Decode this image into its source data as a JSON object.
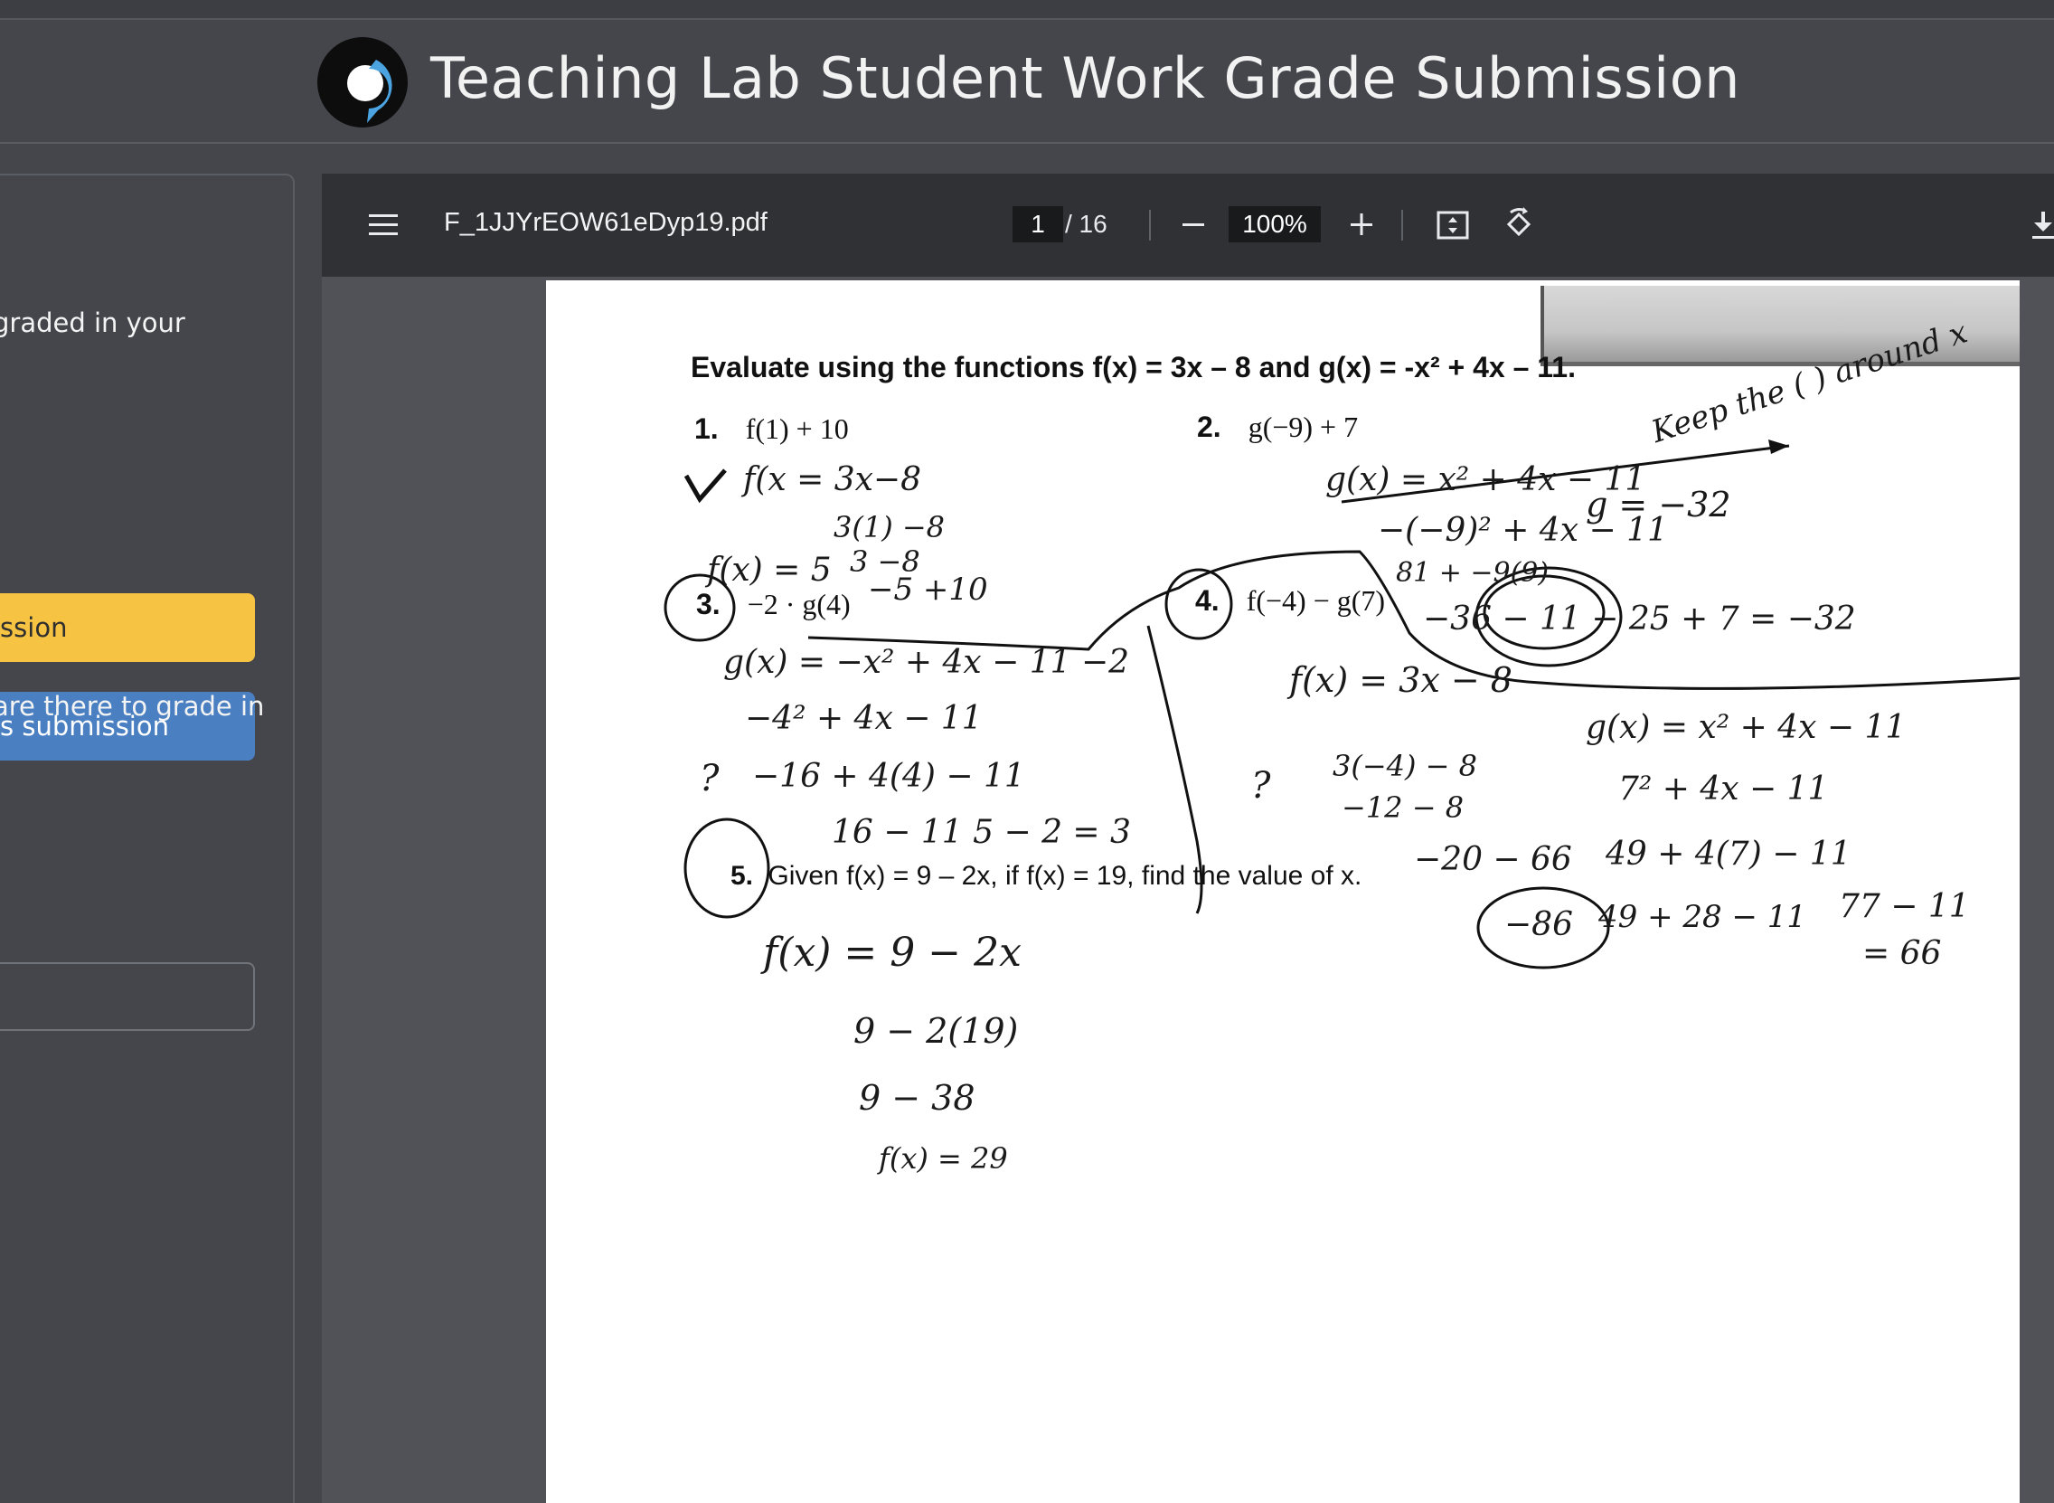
{
  "app": {
    "title": "Teaching Lab Student Work Grade Submission"
  },
  "sidebar": {
    "text_graded": "graded in your",
    "yellow_button": "ission",
    "blue_button": "is submission",
    "text_count": "are there to grade in",
    "input_value": ""
  },
  "viewer": {
    "filename": "F_1JJYrEOW61eDyp19.pdf",
    "page_current": "1",
    "page_total": "/ 16",
    "zoom": "100%",
    "icons": [
      "menu-icon",
      "zoom-out-icon",
      "zoom-in-icon",
      "fit-page-icon",
      "rotate-icon",
      "download-icon"
    ]
  },
  "document": {
    "heading": "Evaluate using the functions f(x) = 3x – 8 and g(x) = -x² + 4x – 11.",
    "q1_num": "1.",
    "q1_expr": "f(1) + 10",
    "q2_num": "2.",
    "q2_expr": "g(−9) + 7",
    "q3_num": "3.",
    "q3_expr": "−2 · g(4)",
    "q4_num": "4.",
    "q4_expr": "f(−4) − g(7)",
    "q5_num": "5.",
    "q5_expr": "Given f(x) = 9 – 2x, if f(x) = 19, find the value of x."
  },
  "handwriting": {
    "q1": [
      "f(x = 3x−8",
      "3(1) −8",
      "3 −8",
      "f(x) = 5",
      "−5 +10"
    ],
    "q2": [
      "g(x) = x² + 4x − 11",
      "−(−9)² + 4x − 11",
      "81 + −9(9)",
      "−36 − 11 − 25 + 7 = −32",
      "g = −32",
      "Keep the ( ) around x"
    ],
    "q3": [
      "g(x) = −x² + 4x − 11   −2",
      "−4² + 4x − 11",
      "−16 + 4(4) − 11",
      "16 − 11   5 − 2 = 3",
      "?"
    ],
    "q4": [
      "f(x) = 3x − 8",
      "3(−4) − 8",
      "−12 − 8",
      "−20 − 66",
      "−86",
      "g(x) = x² + 4x − 11",
      "7² + 4x − 11",
      "49 + 4(7) − 11",
      "49 + 28 − 11",
      "77 − 11",
      "= 66",
      "?"
    ],
    "q5": [
      "f(x) = 9 − 2x",
      "9 − 2(19)",
      "9 − 38",
      "f(x) = 29"
    ]
  },
  "colors": {
    "background": "#44464c",
    "toolbar": "#303134",
    "yellow_button": "#f6c343",
    "blue_button": "#4a7fc1",
    "logo_blue": "#4ba3e0"
  }
}
